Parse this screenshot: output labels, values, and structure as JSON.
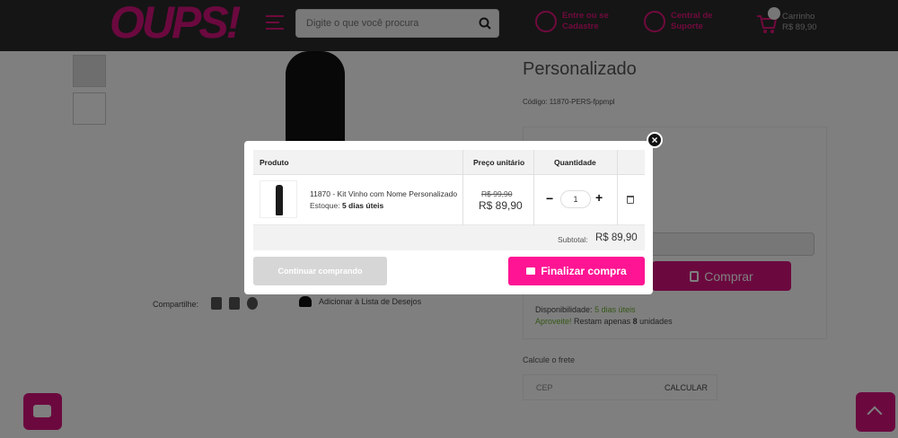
{
  "header": {
    "logo": "OUPS!",
    "search_placeholder": "Digite o que você procura",
    "account_line1": "Entre ou se",
    "account_line2": "Cadastre",
    "support_line1": "Central de",
    "support_line2": "Suporte",
    "cart_label": "Carrinho",
    "cart_total": "R$ 89,90"
  },
  "product_page": {
    "title": "Personalizado",
    "code": "Código: 11870-PERS-fppmpl",
    "buy_label": "Comprar",
    "availability_label": "Disponibilidade:",
    "availability_value": "5 dias úteis",
    "promo_green": "Aproveite!",
    "promo_text": "Restam apenas",
    "promo_count": "8",
    "promo_suffix": "unidades",
    "share_label": "Compartilhe:",
    "wishlist_label": "Adicionar à Lista de Desejos",
    "freight_label": "Calcule o frete",
    "cep_placeholder": "CEP",
    "calc_label": "CALCULAR"
  },
  "modal": {
    "columns": [
      "Produto",
      "Preço unitário",
      "Quantidade"
    ],
    "item": {
      "name": "11870 - Kit Vinho com Nome Personalizado",
      "stock_label": "Estoque:",
      "stock_value": "5 dias úteis",
      "old_price": "R$ 99,90",
      "price": "R$ 89,90",
      "quantity": "1"
    },
    "subtotal_label": "Subtotal:",
    "subtotal_value": "R$ 89,90",
    "continue_label": "Continuar comprando",
    "checkout_label": "Finalizar compra",
    "close_glyph": "×"
  },
  "colors": {
    "brand": "#d6127e",
    "checkout": "#ff1493",
    "header_bg": "#2b2b2b"
  }
}
